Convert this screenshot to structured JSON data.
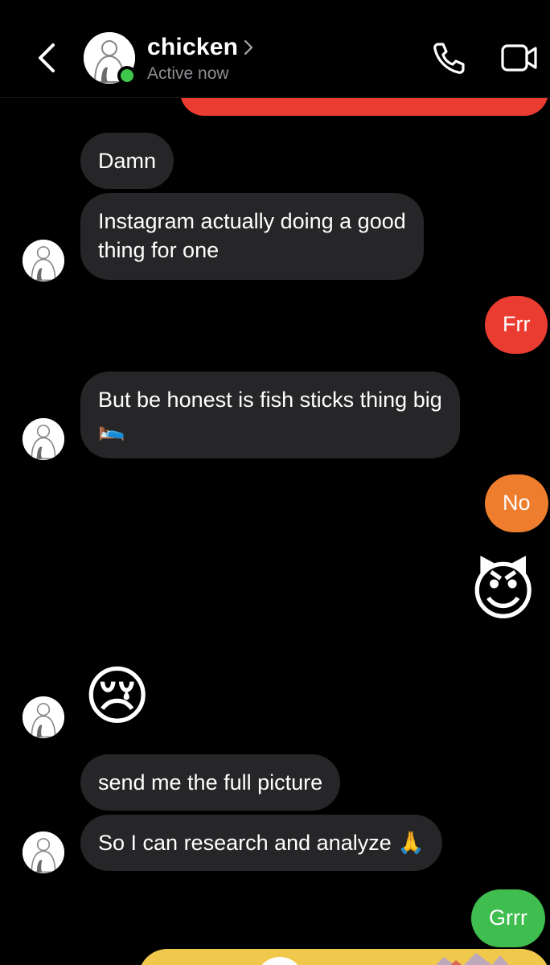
{
  "header": {
    "contact_name": "chicken",
    "status": "Active now",
    "back_icon": "chevron-left-icon",
    "name_chevron_icon": "chevron-right-icon",
    "call_icon": "phone-icon",
    "video_icon": "video-camera-icon",
    "online_color": "#3ec74a"
  },
  "messages": [
    {
      "from": "them",
      "text": "Damn"
    },
    {
      "from": "them",
      "text_line1": "Instagram actually doing a good",
      "text_line2": "thing for one"
    },
    {
      "from": "me",
      "text": "Frr",
      "color": "#ea3c30"
    },
    {
      "from": "them",
      "text_line1": "But be honest is fish sticks thing big",
      "text_line2": "🛌"
    },
    {
      "from": "me",
      "text": "No",
      "color": "#ee7d2e"
    },
    {
      "from": "me",
      "text": "😈",
      "kind": "emoji"
    },
    {
      "from": "them",
      "text": "😢",
      "kind": "emoji"
    },
    {
      "from": "them",
      "text": "send me the full picture"
    },
    {
      "from": "them",
      "text": "So I can research and analyze 🙏"
    },
    {
      "from": "me",
      "text": "Grrr",
      "color": "#3fbd4e"
    }
  ],
  "colors": {
    "incoming_bubble": "#262628",
    "background": "#000000",
    "secondary_text": "#8e8e93"
  }
}
